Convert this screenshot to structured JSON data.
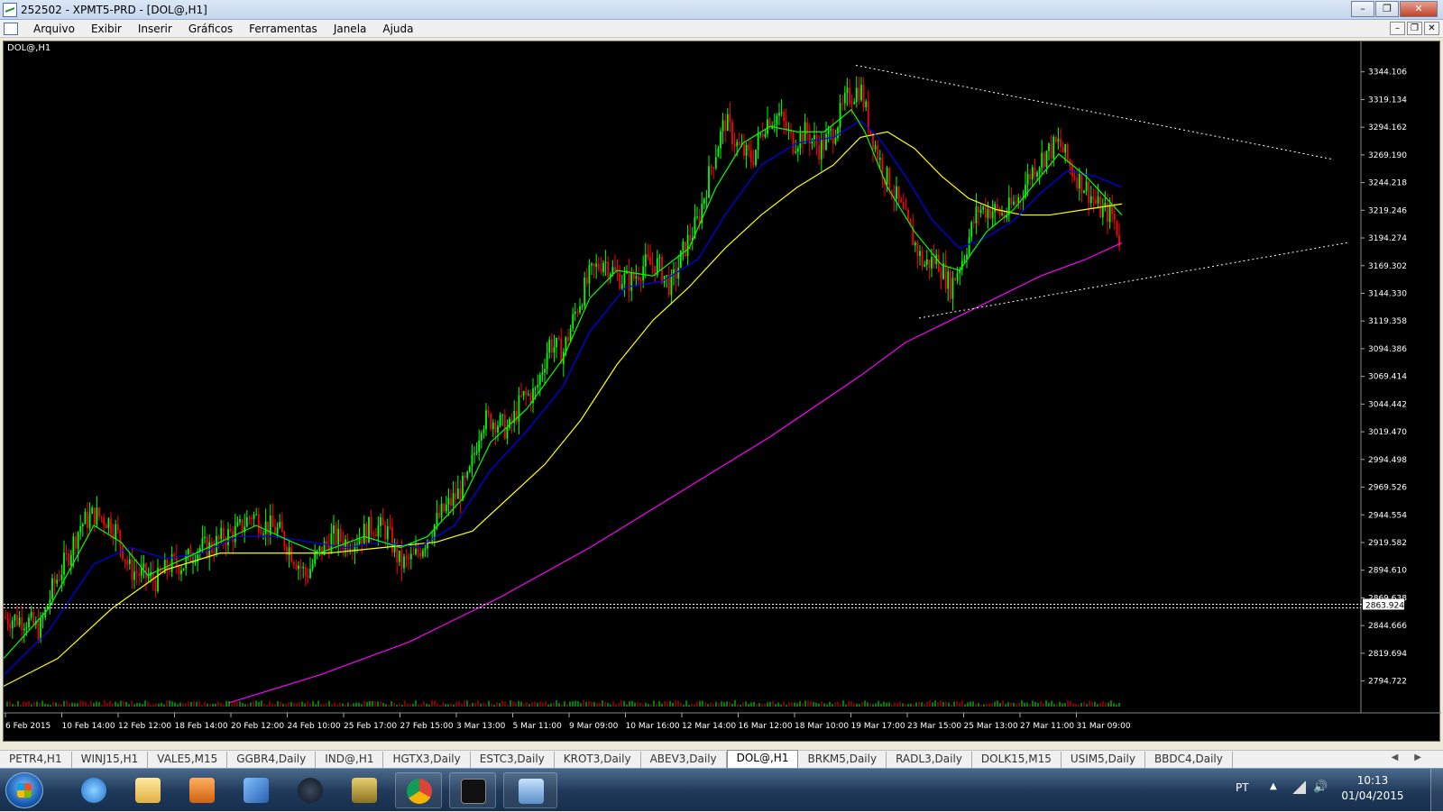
{
  "window": {
    "title": "252502 - XPMT5-PRD - [DOL@,H1]",
    "buttons": {
      "minimize": "–",
      "restore": "❐",
      "close": "✕"
    }
  },
  "menu": {
    "items": [
      "Arquivo",
      "Exibir",
      "Inserir",
      "Gráficos",
      "Ferramentas",
      "Janela",
      "Ajuda"
    ],
    "mdi": {
      "minimize": "–",
      "restore": "❐",
      "close": "✕"
    }
  },
  "chart": {
    "label": "DOL@,H1",
    "current_price": "2863.924",
    "ylim": [
      2770,
      3365
    ],
    "price_ticks": [
      "3344.106",
      "3319.134",
      "3294.162",
      "3269.190",
      "3244.218",
      "3219.246",
      "3194.274",
      "3169.302",
      "3144.330",
      "3119.358",
      "3094.386",
      "3069.414",
      "3044.442",
      "3019.470",
      "2994.498",
      "2969.526",
      "2944.554",
      "2919.582",
      "2894.610",
      "2869.638",
      "2844.666",
      "2819.694",
      "2794.722"
    ],
    "date_labels": [
      "6 Feb 2015",
      "10 Feb 14:00",
      "12 Feb 12:00",
      "18 Feb 14:00",
      "20 Feb 12:00",
      "24 Feb 10:00",
      "25 Feb 17:00",
      "27 Feb 15:00",
      "3 Mar 13:00",
      "5 Mar 11:00",
      "9 Mar 09:00",
      "10 Mar 16:00",
      "12 Mar 14:00",
      "16 Mar 12:00",
      "18 Mar 10:00",
      "19 Mar 17:00",
      "23 Mar 15:00",
      "25 Mar 13:00",
      "27 Mar 11:00",
      "31 Mar 09:00"
    ],
    "colors": {
      "background": "#000000",
      "bull": "#00ff00",
      "bear": "#ff0000",
      "ma_fast": "#00ff00",
      "ma_mid": "#0000ff",
      "ma_slow": "#ffff00",
      "ma_long": "#ff00ff",
      "grid_text": "#ffffff"
    }
  },
  "chart_data": {
    "type": "candlestick",
    "title": "DOL@,H1",
    "ylim": [
      2770,
      3365
    ],
    "close_path": [
      [
        0,
        2852
      ],
      [
        25,
        2850
      ],
      [
        40,
        2840
      ],
      [
        55,
        2880
      ],
      [
        70,
        2905
      ],
      [
        85,
        2935
      ],
      [
        100,
        2945
      ],
      [
        115,
        2940
      ],
      [
        125,
        2930
      ],
      [
        140,
        2895
      ],
      [
        155,
        2890
      ],
      [
        170,
        2885
      ],
      [
        185,
        2900
      ],
      [
        200,
        2900
      ],
      [
        215,
        2915
      ],
      [
        230,
        2915
      ],
      [
        245,
        2925
      ],
      [
        260,
        2930
      ],
      [
        275,
        2945
      ],
      [
        290,
        2935
      ],
      [
        305,
        2930
      ],
      [
        320,
        2910
      ],
      [
        335,
        2890
      ],
      [
        350,
        2910
      ],
      [
        365,
        2925
      ],
      [
        380,
        2920
      ],
      [
        395,
        2925
      ],
      [
        410,
        2935
      ],
      [
        425,
        2930
      ],
      [
        440,
        2900
      ],
      [
        455,
        2905
      ],
      [
        470,
        2925
      ],
      [
        485,
        2945
      ],
      [
        500,
        2960
      ],
      [
        515,
        2975
      ],
      [
        530,
        3030
      ],
      [
        545,
        3030
      ],
      [
        560,
        3020
      ],
      [
        575,
        3050
      ],
      [
        590,
        3055
      ],
      [
        605,
        3100
      ],
      [
        620,
        3090
      ],
      [
        635,
        3130
      ],
      [
        650,
        3160
      ],
      [
        665,
        3175
      ],
      [
        680,
        3160
      ],
      [
        695,
        3155
      ],
      [
        710,
        3170
      ],
      [
        725,
        3170
      ],
      [
        740,
        3150
      ],
      [
        755,
        3185
      ],
      [
        770,
        3210
      ],
      [
        785,
        3260
      ],
      [
        800,
        3300
      ],
      [
        815,
        3275
      ],
      [
        830,
        3265
      ],
      [
        845,
        3300
      ],
      [
        860,
        3305
      ],
      [
        875,
        3280
      ],
      [
        890,
        3290
      ],
      [
        905,
        3275
      ],
      [
        920,
        3290
      ],
      [
        935,
        3320
      ],
      [
        950,
        3330
      ],
      [
        960,
        3295
      ],
      [
        975,
        3255
      ],
      [
        990,
        3230
      ],
      [
        1005,
        3200
      ],
      [
        1020,
        3170
      ],
      [
        1035,
        3175
      ],
      [
        1050,
        3150
      ],
      [
        1065,
        3180
      ],
      [
        1080,
        3220
      ],
      [
        1095,
        3220
      ],
      [
        1110,
        3215
      ],
      [
        1125,
        3230
      ],
      [
        1140,
        3255
      ],
      [
        1155,
        3270
      ],
      [
        1170,
        3280
      ],
      [
        1185,
        3255
      ],
      [
        1200,
        3240
      ],
      [
        1215,
        3220
      ],
      [
        1230,
        3215
      ],
      [
        1240,
        3185
      ]
    ],
    "ma_fast": [
      [
        0,
        2815
      ],
      [
        50,
        2860
      ],
      [
        100,
        2935
      ],
      [
        130,
        2920
      ],
      [
        160,
        2890
      ],
      [
        200,
        2905
      ],
      [
        240,
        2920
      ],
      [
        280,
        2935
      ],
      [
        320,
        2920
      ],
      [
        350,
        2910
      ],
      [
        400,
        2925
      ],
      [
        440,
        2915
      ],
      [
        470,
        2925
      ],
      [
        510,
        2960
      ],
      [
        540,
        3010
      ],
      [
        580,
        3040
      ],
      [
        620,
        3085
      ],
      [
        650,
        3140
      ],
      [
        680,
        3165
      ],
      [
        720,
        3160
      ],
      [
        760,
        3185
      ],
      [
        790,
        3240
      ],
      [
        820,
        3280
      ],
      [
        850,
        3295
      ],
      [
        880,
        3290
      ],
      [
        910,
        3290
      ],
      [
        940,
        3310
      ],
      [
        955,
        3290
      ],
      [
        980,
        3240
      ],
      [
        1010,
        3200
      ],
      [
        1040,
        3170
      ],
      [
        1060,
        3165
      ],
      [
        1090,
        3200
      ],
      [
        1120,
        3220
      ],
      [
        1150,
        3250
      ],
      [
        1170,
        3270
      ],
      [
        1200,
        3250
      ],
      [
        1240,
        3215
      ]
    ],
    "ma_mid": [
      [
        0,
        2800
      ],
      [
        50,
        2840
      ],
      [
        100,
        2900
      ],
      [
        140,
        2915
      ],
      [
        180,
        2905
      ],
      [
        220,
        2910
      ],
      [
        260,
        2925
      ],
      [
        300,
        2925
      ],
      [
        340,
        2920
      ],
      [
        380,
        2915
      ],
      [
        420,
        2920
      ],
      [
        460,
        2915
      ],
      [
        500,
        2935
      ],
      [
        540,
        2985
      ],
      [
        580,
        3020
      ],
      [
        620,
        3060
      ],
      [
        650,
        3110
      ],
      [
        690,
        3150
      ],
      [
        730,
        3155
      ],
      [
        770,
        3175
      ],
      [
        800,
        3215
      ],
      [
        840,
        3260
      ],
      [
        880,
        3280
      ],
      [
        920,
        3285
      ],
      [
        950,
        3300
      ],
      [
        970,
        3285
      ],
      [
        1000,
        3250
      ],
      [
        1030,
        3210
      ],
      [
        1060,
        3185
      ],
      [
        1090,
        3195
      ],
      [
        1120,
        3210
      ],
      [
        1150,
        3235
      ],
      [
        1180,
        3255
      ],
      [
        1210,
        3250
      ],
      [
        1240,
        3240
      ]
    ],
    "ma_slow": [
      [
        0,
        2790
      ],
      [
        60,
        2815
      ],
      [
        120,
        2860
      ],
      [
        180,
        2895
      ],
      [
        240,
        2910
      ],
      [
        300,
        2910
      ],
      [
        360,
        2910
      ],
      [
        420,
        2915
      ],
      [
        480,
        2920
      ],
      [
        520,
        2930
      ],
      [
        560,
        2960
      ],
      [
        600,
        2990
      ],
      [
        640,
        3030
      ],
      [
        680,
        3080
      ],
      [
        720,
        3120
      ],
      [
        760,
        3150
      ],
      [
        800,
        3185
      ],
      [
        840,
        3215
      ],
      [
        880,
        3240
      ],
      [
        920,
        3260
      ],
      [
        950,
        3285
      ],
      [
        980,
        3290
      ],
      [
        1010,
        3275
      ],
      [
        1040,
        3250
      ],
      [
        1070,
        3230
      ],
      [
        1100,
        3220
      ],
      [
        1130,
        3215
      ],
      [
        1160,
        3215
      ],
      [
        1200,
        3220
      ],
      [
        1240,
        3225
      ]
    ],
    "ma_long": [
      [
        250,
        2775
      ],
      [
        350,
        2800
      ],
      [
        450,
        2830
      ],
      [
        550,
        2870
      ],
      [
        650,
        2915
      ],
      [
        750,
        2965
      ],
      [
        850,
        3015
      ],
      [
        950,
        3070
      ],
      [
        1000,
        3100
      ],
      [
        1050,
        3120
      ],
      [
        1100,
        3140
      ],
      [
        1150,
        3160
      ],
      [
        1200,
        3175
      ],
      [
        1240,
        3190
      ]
    ],
    "trendlines": [
      {
        "from": [
          945,
          3350
        ],
        "to": [
          1475,
          3265
        ],
        "style": "dotted"
      },
      {
        "from": [
          1015,
          3122
        ],
        "to": [
          1490,
          3190
        ],
        "style": "dotted"
      }
    ],
    "hline": 2863.924
  }
}
